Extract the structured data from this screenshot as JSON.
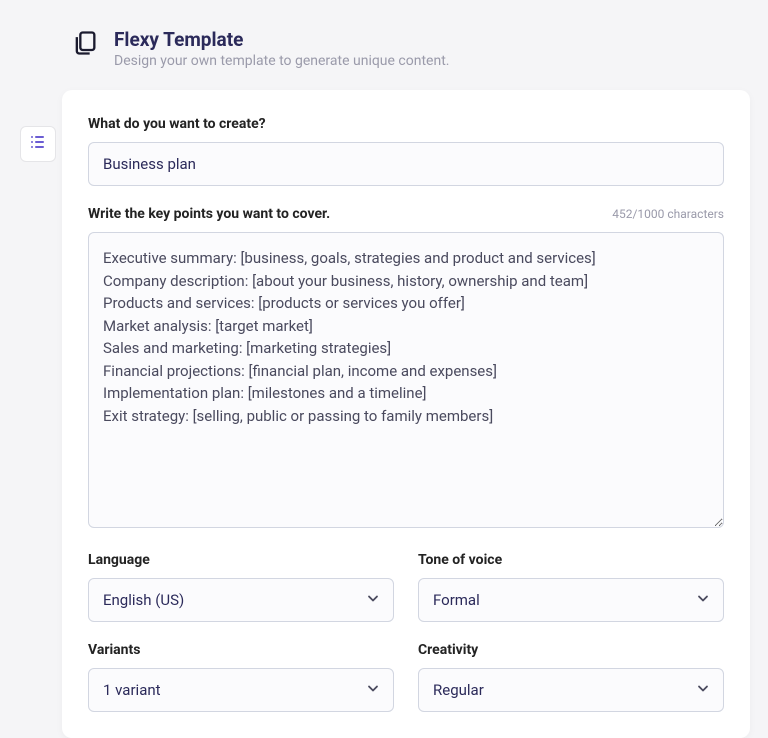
{
  "header": {
    "title": "Flexy Template",
    "subtitle": "Design your own template to generate unique content."
  },
  "form": {
    "create_label": "What do you want to create?",
    "create_value": "Business plan",
    "keypoints_label": "Write the key points you want to cover.",
    "keypoints_count": "452/1000 characters",
    "keypoints_value": "Executive summary: [business, goals, strategies and product and services]\nCompany description: [about your business, history, ownership and team]\nProducts and services: [products or services you offer]\nMarket analysis: [target market]\nSales and marketing: [marketing strategies]\nFinancial projections: [financial plan, income and expenses]\nImplementation plan: [milestones and a timeline]\nExit strategy: [selling, public or passing to family members]",
    "language_label": "Language",
    "language_value": "English (US)",
    "tone_label": "Tone of voice",
    "tone_value": "Formal",
    "variants_label": "Variants",
    "variants_value": "1 variant",
    "creativity_label": "Creativity",
    "creativity_value": "Regular"
  }
}
